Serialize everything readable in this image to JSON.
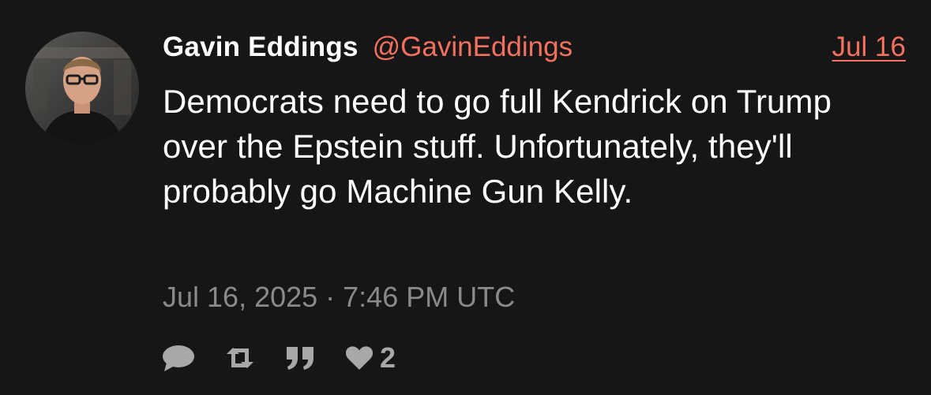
{
  "tweet": {
    "author": {
      "full_name": "Gavin Eddings",
      "username": "@GavinEddings"
    },
    "date_short": "Jul 16",
    "content": "Democrats need to go full Kendrick on Trump over the Epstein stuff. Unfortunately, they'll probably go Machine Gun Kelly.",
    "timestamp": "Jul 16, 2025 · 7:46 PM UTC",
    "stats": {
      "likes": "2"
    },
    "actions": [
      {
        "icon": "comment-icon"
      },
      {
        "icon": "retweet-icon"
      },
      {
        "icon": "quote-icon"
      },
      {
        "icon": "heart-icon"
      }
    ]
  },
  "colors": {
    "background": "#161616",
    "accent": "#f4705f",
    "text": "#ffffff",
    "muted": "#8a8a8a",
    "icon": "#a8a8a8"
  }
}
